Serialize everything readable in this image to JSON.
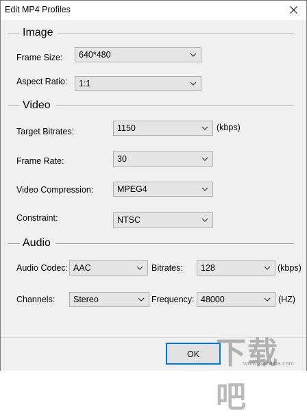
{
  "window": {
    "title": "Edit MP4 Profiles"
  },
  "image": {
    "heading": "Image",
    "frame_size": {
      "label": "Frame Size:",
      "value": "640*480"
    },
    "aspect_ratio": {
      "label": "Aspect Ratio:",
      "value": "1:1"
    }
  },
  "video": {
    "heading": "Video",
    "target_bitrates": {
      "label": "Target Bitrates:",
      "value": "1150",
      "unit": "(kbps)"
    },
    "frame_rate": {
      "label": "Frame Rate:",
      "value": "30"
    },
    "video_compression": {
      "label": "Video Compression:",
      "value": "MPEG4"
    },
    "constraint": {
      "label": "Constraint:",
      "value": "NTSC"
    }
  },
  "audio": {
    "heading": "Audio",
    "audio_codec": {
      "label": "Audio Codec:",
      "value": "AAC"
    },
    "bitrates": {
      "label": "Bitrates:",
      "value": "128",
      "unit": "(kbps)"
    },
    "channels": {
      "label": "Channels:",
      "value": "Stereo"
    },
    "frequency": {
      "label": "Frequency:",
      "value": "48000",
      "unit": "(HZ)"
    }
  },
  "footer": {
    "ok_label": "OK"
  },
  "watermark": {
    "text": "下载吧",
    "url": "www.xiazaiba.com"
  },
  "colors": {
    "accent": "#0078d7",
    "dialog_bg": "#f0f0f0",
    "combo_bg": "#e5e5e5"
  }
}
